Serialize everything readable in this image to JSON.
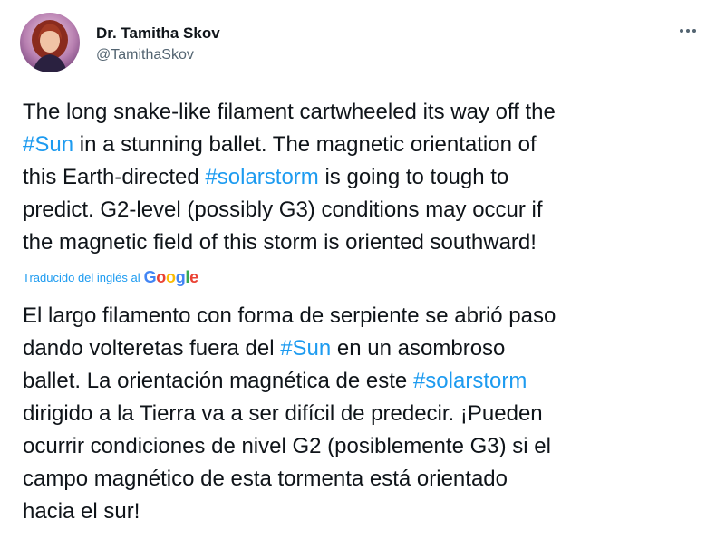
{
  "author": {
    "display_name": "Dr. Tamitha Skov",
    "handle": "@TamithaSkov"
  },
  "menu": {
    "icon": "more-horizontal-icon"
  },
  "original": {
    "lines": [
      [
        {
          "t": "The long snake-like filament cartwheeled its way off the"
        }
      ],
      [
        {
          "t": "#Sun",
          "tag": true
        },
        {
          "t": " in a stunning ballet. The magnetic orientation of"
        }
      ],
      [
        {
          "t": "this Earth-directed "
        },
        {
          "t": "#solarstorm",
          "tag": true
        },
        {
          "t": " is going to tough to"
        }
      ],
      [
        {
          "t": "predict. G2-level (possibly G3) conditions may occur if"
        }
      ],
      [
        {
          "t": "the magnetic field of this storm is oriented southward!"
        }
      ]
    ]
  },
  "translation_credit": {
    "label": "Traducido del inglés al",
    "logo_letters": [
      "G",
      "o",
      "o",
      "g",
      "l",
      "e"
    ],
    "logo_colors": [
      "#4285f4",
      "#ea4335",
      "#fbbc05",
      "#4285f4",
      "#34a853",
      "#ea4335"
    ]
  },
  "translated": {
    "lines": [
      [
        {
          "t": "El largo filamento con forma de serpiente se abrió paso"
        }
      ],
      [
        {
          "t": "dando volteretas fuera del "
        },
        {
          "t": "#Sun",
          "tag": true
        },
        {
          "t": " en un asombroso"
        }
      ],
      [
        {
          "t": "ballet. La orientación magnética de este "
        },
        {
          "t": "#solarstorm",
          "tag": true
        }
      ],
      [
        {
          "t": "dirigido a la Tierra va a ser difícil de predecir. ¡Pueden"
        }
      ],
      [
        {
          "t": "ocurrir condiciones de nivel G2 (posiblemente G3) si el"
        }
      ],
      [
        {
          "t": "campo magnético de esta tormenta está orientado"
        }
      ],
      [
        {
          "t": "hacia el sur!"
        }
      ]
    ]
  },
  "colors": {
    "link": "#1d9bf0",
    "text": "#0f1419",
    "secondary": "#536471"
  }
}
